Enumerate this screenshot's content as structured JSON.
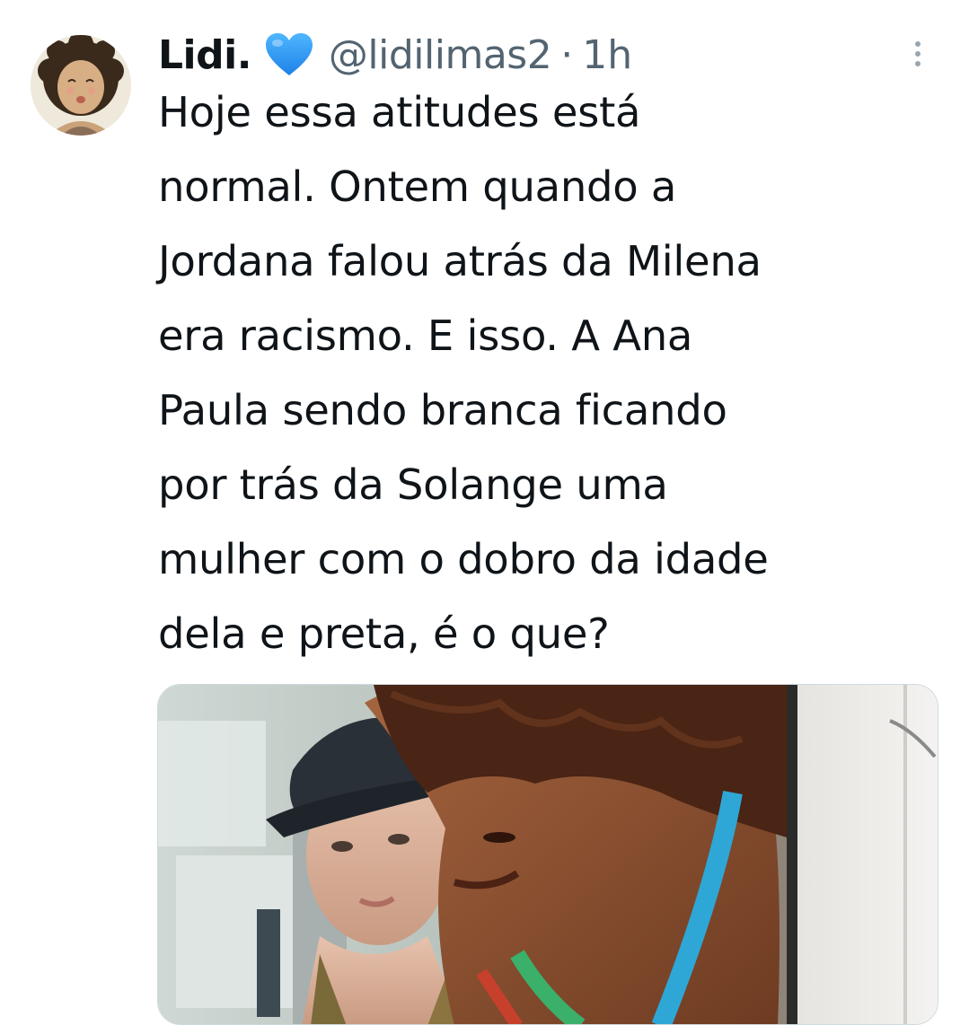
{
  "tweet": {
    "author_name": "Lidi.",
    "verified_emoji": "💙",
    "handle": "@lidilimas2",
    "separator": "·",
    "time": "1h",
    "text_lines": [
      "Hoje essa atitudes está",
      "normal. Ontem quando a",
      "Jordana falou atrás da Milena",
      "era racismo. E isso. A Ana",
      "Paula sendo branca ficando",
      "por trás da Solange uma",
      "mulher com o dobro da idade",
      "dela e preta, é o que?"
    ]
  },
  "icons": {
    "avatar": "cartoon-avatar",
    "verified": "blue-heart-icon",
    "more": "more-options-icon"
  },
  "colors": {
    "text": "#0f1419",
    "secondary": "#536471",
    "heart": "#1d9bf0"
  }
}
